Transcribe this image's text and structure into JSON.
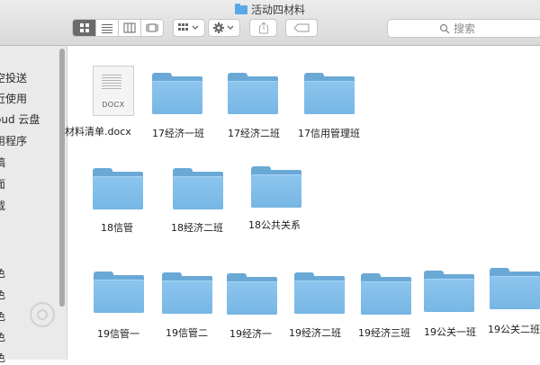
{
  "window": {
    "title": "活动四材料"
  },
  "toolbar": {
    "view_modes": [
      "icon-view",
      "list-view",
      "column-view",
      "gallery-view"
    ],
    "active_view": "icon-view",
    "group_by_label": "group",
    "action_label": "action",
    "share_label": "share",
    "tags_label": "tags"
  },
  "search": {
    "placeholder": "搜索"
  },
  "sidebar": {
    "items": [
      {
        "label": "空投送"
      },
      {
        "label": "近使用"
      },
      {
        "label": "oud 云盘"
      },
      {
        "label": "用程序"
      },
      {
        "label": "稿"
      },
      {
        "label": "面"
      },
      {
        "label": "载"
      },
      {
        "label": "色"
      },
      {
        "label": "色"
      },
      {
        "label": "色"
      },
      {
        "label": "色"
      },
      {
        "label": "色"
      }
    ]
  },
  "files": [
    {
      "name": "材料清单.docx",
      "kind": "docx",
      "badge": "DOCX"
    },
    {
      "name": "17经济一班",
      "kind": "folder"
    },
    {
      "name": "17经济二班",
      "kind": "folder"
    },
    {
      "name": "17信用管理班",
      "kind": "folder"
    },
    {
      "name": "18信管",
      "kind": "folder"
    },
    {
      "name": "18经济二班",
      "kind": "folder"
    },
    {
      "name": "18公共关系",
      "kind": "folder"
    },
    {
      "name": "19信管一",
      "kind": "folder"
    },
    {
      "name": "19信管二",
      "kind": "folder"
    },
    {
      "name": "19经济一",
      "kind": "folder"
    },
    {
      "name": "19经济二班",
      "kind": "folder"
    },
    {
      "name": "19经济三班",
      "kind": "folder"
    },
    {
      "name": "19公关一班",
      "kind": "folder"
    },
    {
      "name": "19公关二班",
      "kind": "folder"
    }
  ]
}
